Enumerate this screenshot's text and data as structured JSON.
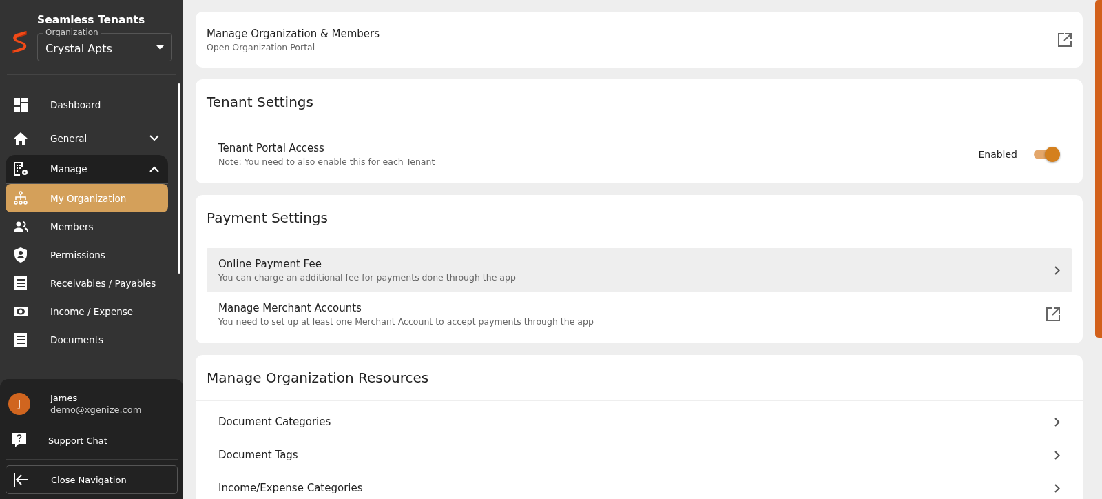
{
  "app": {
    "name": "Seamless Tenants"
  },
  "organization": {
    "label": "Organization",
    "value": "Crystal Apts"
  },
  "nav": [
    {
      "label": "Dashboard",
      "selected": false
    },
    {
      "label": "General",
      "expanded": false,
      "selected": false
    },
    {
      "label": "Manage",
      "expanded": true,
      "selected": false,
      "children": [
        {
          "label": "My Organization",
          "selected": true
        },
        {
          "label": "Members",
          "selected": false
        },
        {
          "label": "Permissions",
          "selected": false
        },
        {
          "label": "Receivables / Payables",
          "selected": false
        },
        {
          "label": "Income / Expense",
          "selected": false
        },
        {
          "label": "Documents",
          "selected": false
        }
      ]
    }
  ],
  "user": {
    "initial": "J",
    "name": "James",
    "email": "demo@xgenize.com"
  },
  "support": {
    "label": "Support Chat"
  },
  "close_nav": {
    "label": "Close Navigation"
  },
  "cards": [
    {
      "kind": "link",
      "title": "Manage Organization & Members",
      "subtitle": "Open Organization Portal"
    },
    {
      "kind": "section",
      "title": "Tenant Settings",
      "rows": [
        {
          "kind": "toggle",
          "title": "Tenant Portal Access",
          "subtitle": "Note: You need to also enable this for each Tenant",
          "state_label": "Enabled",
          "on": true,
          "highlighted": false
        }
      ]
    },
    {
      "kind": "section",
      "title": "Payment Settings",
      "rows": [
        {
          "kind": "chevron",
          "title": "Online Payment Fee",
          "subtitle": "You can charge an additional fee for payments done through the app",
          "highlighted": true
        },
        {
          "kind": "external",
          "title": "Manage Merchant Accounts",
          "subtitle": "You need to set up at least one Merchant Account to accept payments through the app",
          "highlighted": false
        }
      ]
    },
    {
      "kind": "section",
      "title": "Manage Organization Resources",
      "rows": [
        {
          "kind": "chevron",
          "title": "Document Categories",
          "highlighted": false
        },
        {
          "kind": "chevron",
          "title": "Document Tags",
          "highlighted": false
        },
        {
          "kind": "chevron",
          "title": "Income/Expense Categories",
          "highlighted": false
        }
      ]
    }
  ]
}
